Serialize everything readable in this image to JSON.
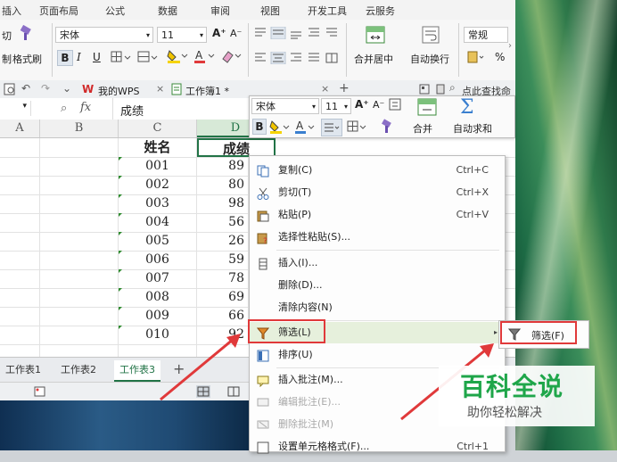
{
  "menu": [
    "插入",
    "页面布局",
    "公式",
    "数据",
    "审阅",
    "视图",
    "开发工具",
    "云服务"
  ],
  "ribbon": {
    "clipboard_cut": "切",
    "clipboard_copy": "制",
    "format_painter": "格式刷",
    "font_name": "宋体",
    "font_size": "11",
    "bold": "B",
    "italic": "I",
    "underline": "U",
    "font_grow": "A⁺",
    "font_shrink": "A⁻",
    "merge_center": "合并居中",
    "wrap_text": "自动换行",
    "number_format": "常规",
    "percent": "%"
  },
  "tabs": {
    "mywps": "我的WPS",
    "workbook": "工作簿1 *",
    "search": "点此查找命令"
  },
  "formula": {
    "fx": "fx",
    "value": "成绩"
  },
  "columns": [
    "A",
    "B",
    "C",
    "D"
  ],
  "table": {
    "header_name": "姓名",
    "header_score": "成绩",
    "rows": [
      {
        "id": "001",
        "score": "89"
      },
      {
        "id": "002",
        "score": "80"
      },
      {
        "id": "003",
        "score": "98"
      },
      {
        "id": "004",
        "score": "56"
      },
      {
        "id": "005",
        "score": "26"
      },
      {
        "id": "006",
        "score": "59"
      },
      {
        "id": "007",
        "score": "78"
      },
      {
        "id": "008",
        "score": "69"
      },
      {
        "id": "009",
        "score": "66"
      },
      {
        "id": "010",
        "score": "92"
      }
    ]
  },
  "sheets": [
    "工作表1",
    "工作表2",
    "工作表3"
  ],
  "active_sheet": "工作表3",
  "mini_toolbar": {
    "font_name": "宋体",
    "font_size": "11",
    "bold": "B",
    "merge": "合并",
    "autosum": "自动求和"
  },
  "context_menu": [
    {
      "label": "复制(C)",
      "shortcut": "Ctrl+C",
      "icon": "copy-icon"
    },
    {
      "label": "剪切(T)",
      "shortcut": "Ctrl+X",
      "icon": "scissors-icon"
    },
    {
      "label": "粘贴(P)",
      "shortcut": "Ctrl+V",
      "icon": "paste-icon"
    },
    {
      "label": "选择性粘贴(S)...",
      "shortcut": "",
      "icon": "paste-special-icon"
    },
    {
      "label": "插入(I)...",
      "shortcut": "",
      "icon": "insert-icon"
    },
    {
      "label": "删除(D)...",
      "shortcut": "",
      "icon": ""
    },
    {
      "label": "清除内容(N)",
      "shortcut": "",
      "icon": ""
    },
    {
      "label": "筛选(L)",
      "shortcut": "",
      "icon": "filter-icon"
    },
    {
      "label": "排序(U)",
      "shortcut": "",
      "icon": "sort-icon"
    },
    {
      "label": "插入批注(M)...",
      "shortcut": "",
      "icon": "comment-icon"
    },
    {
      "label": "编辑批注(E)...",
      "shortcut": "",
      "icon": "edit-comment-icon"
    },
    {
      "label": "删除批注(M)",
      "shortcut": "",
      "icon": "delete-comment-icon"
    },
    {
      "label": "设置单元格格式(F)...",
      "shortcut": "Ctrl+1",
      "icon": "format-cells-icon"
    }
  ],
  "submenu": {
    "label": "筛选(F)"
  },
  "watermark": {
    "title": "百科全说",
    "subtitle": "助你轻松解决"
  },
  "colors": {
    "highlight": "#e0393a",
    "arrow": "#e0393a",
    "accent_green": "#217346",
    "watermark_green": "#1fa64a"
  }
}
